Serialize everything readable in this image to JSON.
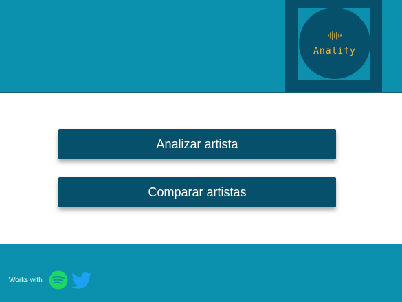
{
  "logo": {
    "text": "Analify"
  },
  "actions": {
    "analyze_label": "Analizar artista",
    "compare_label": "Comparar artistas"
  },
  "footer": {
    "works_with": "Works with",
    "icons": [
      "spotify-icon",
      "twitter-icon"
    ]
  },
  "colors": {
    "primary": "#0b90ad",
    "dark": "#07506c",
    "logo_accent": "#f0b740",
    "spotify": "#1ed760",
    "twitter": "#1da1f2"
  }
}
